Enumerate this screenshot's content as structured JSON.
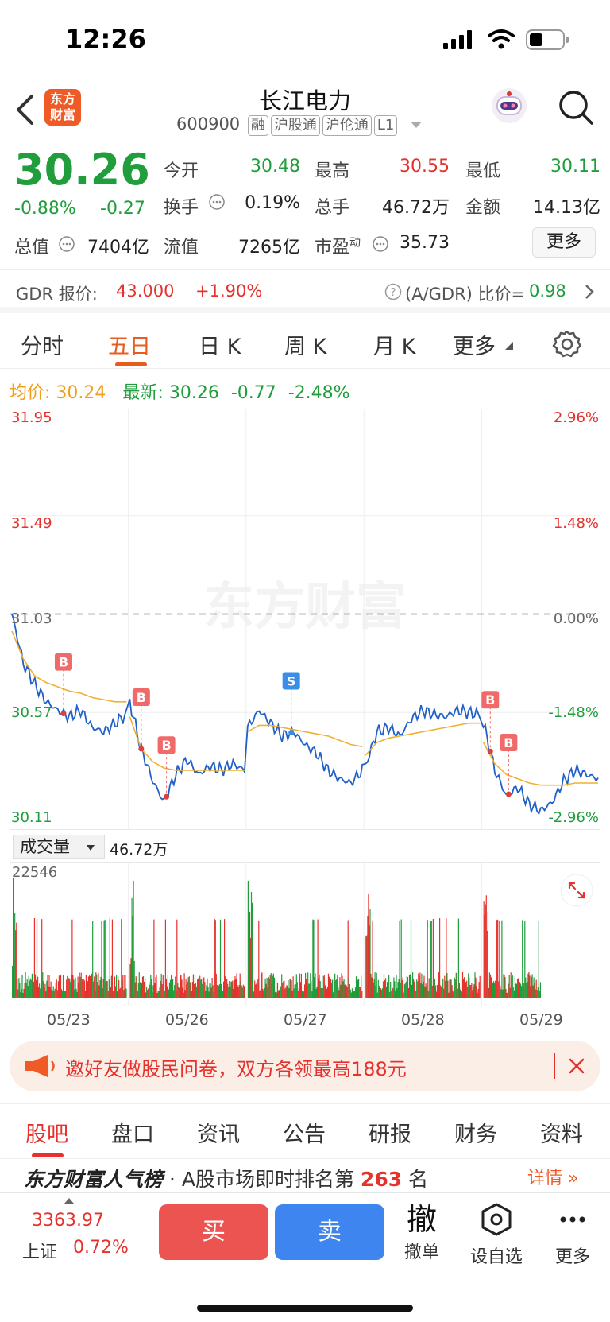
{
  "status": {
    "time": "12:26"
  },
  "header": {
    "title": "长江电力",
    "code": "600900",
    "tags": [
      "融",
      "沪股通",
      "沪伦通",
      "L1"
    ],
    "logo_text": "东方财富"
  },
  "quote": {
    "price": "30.26",
    "change_pct": "-0.88%",
    "change": "-0.27",
    "open_label": "今开",
    "open": "30.48",
    "high_label": "最高",
    "high": "30.55",
    "low_label": "最低",
    "low": "30.11",
    "turnover_label": "换手",
    "turnover": "0.19%",
    "volume_label": "总手",
    "volume": "46.72万",
    "amount_label": "金额",
    "amount": "14.13亿",
    "mktcap_label": "总值",
    "mktcap": "7404亿",
    "float_label": "流值",
    "float": "7265亿",
    "pe_label": "市盈",
    "pe_sup": "动",
    "pe": "35.73",
    "more_label": "更多"
  },
  "gdr": {
    "label": "GDR 报价:",
    "price": "43.000",
    "change": "+1.90%",
    "ratio_label": "(A/GDR) 比价=",
    "ratio": "0.98"
  },
  "period_tabs": [
    "分时",
    "五日",
    "日 K",
    "周 K",
    "月 K",
    "更多"
  ],
  "active_period": "五日",
  "legend": {
    "avg_label": "均价:",
    "avg": "30.24",
    "latest_label": "最新:",
    "latest": "30.26",
    "change": "-0.77",
    "change_pct": "-2.48%"
  },
  "watermark": "东方财富",
  "chart_data": {
    "type": "line",
    "title": "",
    "x": [
      "05/23",
      "05/26",
      "05/27",
      "05/28",
      "05/29"
    ],
    "ylim": [
      30.11,
      31.95
    ],
    "y_ticks_left": [
      "31.95",
      "31.49",
      "31.03",
      "30.57",
      "30.11"
    ],
    "y_ticks_right": [
      "2.96%",
      "1.48%",
      "0.00%",
      "-1.48%",
      "-2.96%"
    ],
    "prev_close": 31.03,
    "series": [
      {
        "name": "最新",
        "color": "#2060c8",
        "day_points": [
          [
            31.03,
            30.8,
            30.7,
            30.62,
            30.58,
            30.55,
            30.58,
            30.5,
            30.48,
            30.52,
            30.56
          ],
          [
            30.62,
            30.4,
            30.25,
            30.15,
            30.28,
            30.35,
            30.28,
            30.32,
            30.3,
            30.33,
            30.3
          ],
          [
            30.5,
            30.58,
            30.52,
            30.46,
            30.48,
            30.42,
            30.38,
            30.3,
            30.26,
            30.24,
            30.3
          ],
          [
            30.32,
            30.48,
            30.5,
            30.46,
            30.54,
            30.58,
            30.56,
            30.55,
            30.58,
            30.57,
            30.56
          ],
          [
            30.52,
            30.3,
            30.18,
            30.22,
            30.14,
            30.11,
            30.15,
            30.25,
            30.3,
            30.28,
            30.26
          ]
        ]
      },
      {
        "name": "均价",
        "color": "#f0b030",
        "day_points": [
          [
            30.95,
            30.82,
            30.74,
            30.71,
            30.69,
            30.67,
            30.66,
            30.64,
            30.63,
            30.62,
            30.62
          ],
          [
            30.55,
            30.4,
            30.34,
            30.31,
            30.3,
            30.3,
            30.3,
            30.3,
            30.3,
            30.3,
            30.3
          ],
          [
            30.48,
            30.51,
            30.51,
            30.5,
            30.49,
            30.48,
            30.47,
            30.46,
            30.44,
            30.42,
            30.41
          ],
          [
            30.37,
            30.43,
            30.45,
            30.46,
            30.47,
            30.48,
            30.49,
            30.5,
            30.51,
            30.52,
            30.52
          ],
          [
            30.43,
            30.33,
            30.28,
            30.26,
            30.24,
            30.23,
            30.23,
            30.23,
            30.24,
            30.24,
            30.24
          ]
        ]
      }
    ],
    "markers": [
      {
        "label": "B",
        "day": 0,
        "pos": 0.45
      },
      {
        "label": "B",
        "day": 1,
        "pos": 0.1
      },
      {
        "label": "B",
        "day": 1,
        "pos": 0.32
      },
      {
        "label": "S",
        "day": 2,
        "pos": 0.38
      },
      {
        "label": "B",
        "day": 4,
        "pos": 0.06
      },
      {
        "label": "B",
        "day": 4,
        "pos": 0.22
      }
    ]
  },
  "volume": {
    "selector_label": "成交量",
    "total": "46.72万",
    "max_label": "22546"
  },
  "banner": {
    "text": "邀好友做股民问卷，双方各领最高188元"
  },
  "sub_tabs": [
    "股吧",
    "盘口",
    "资讯",
    "公告",
    "研报",
    "财务",
    "资料"
  ],
  "active_sub_tab": "股吧",
  "rank": {
    "brand": "东方财富人气榜",
    "text": "· A股市场即时排名第",
    "rank": "263",
    "suffix": "名",
    "detail": "详情"
  },
  "bottom": {
    "index_value": "3363.97",
    "index_name": "上证",
    "index_change": "0.72%",
    "buy": "买",
    "sell": "卖",
    "cancel_icon": "撤",
    "cancel": "撤单",
    "watch": "设自选",
    "more": "更多"
  }
}
